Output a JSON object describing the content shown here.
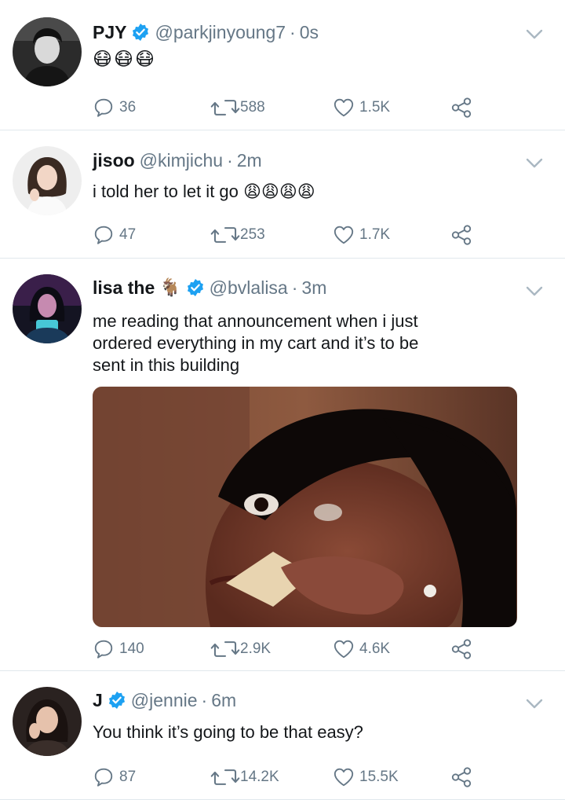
{
  "colors": {
    "accent": "#1da1f2",
    "secondary_text": "#657786",
    "divider": "#e1e8ed"
  },
  "tweets": [
    {
      "display_name": "PJY",
      "handle": "@parkjinyoung7",
      "separator": "·",
      "time": "0s",
      "text": "😷😷😷",
      "replies": "36",
      "retweets": "588",
      "likes": "1.5K"
    },
    {
      "display_name": "jisoo",
      "handle": "@kimjichu",
      "separator": "·",
      "time": "2m",
      "text": "i told her to let it go 😩😩😩😩",
      "replies": "47",
      "retweets": "253",
      "likes": "1.7K"
    },
    {
      "display_name": "lisa the",
      "name_emoji": "🐐",
      "handle": "@bvlalisa",
      "separator": "·",
      "time": "3m",
      "text_lines": [
        "me reading that announcement when i just",
        "ordered everything in my cart and it’s to be",
        "sent in this building"
      ],
      "replies": "140",
      "retweets": "2.9K",
      "likes": "4.6K"
    },
    {
      "display_name": "J",
      "handle": "@jennie",
      "separator": "·",
      "time": "6m",
      "text": "You think it’s going to be that easy?",
      "replies": "87",
      "retweets": "14.2K",
      "likes": "15.5K"
    }
  ],
  "icons": {
    "reply": "reply-icon",
    "retweet": "retweet-icon",
    "like": "heart-icon",
    "share": "share-icon",
    "more": "chevron-down-icon",
    "verified": "verified-badge-icon"
  }
}
